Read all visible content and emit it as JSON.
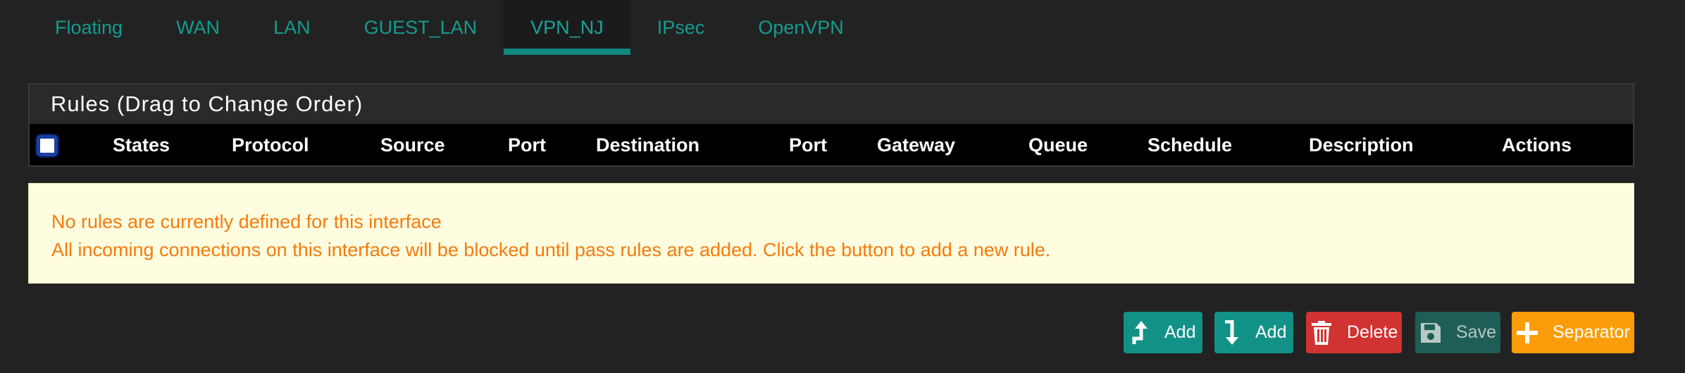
{
  "tabs": [
    {
      "label": "Floating"
    },
    {
      "label": "WAN"
    },
    {
      "label": "LAN"
    },
    {
      "label": "GUEST_LAN"
    },
    {
      "label": "VPN_NJ"
    },
    {
      "label": "IPsec"
    },
    {
      "label": "OpenVPN"
    }
  ],
  "active_tab": "VPN_NJ",
  "panel": {
    "heading": "Rules (Drag to Change Order)",
    "columns": [
      "States",
      "Protocol",
      "Source",
      "Port",
      "Destination",
      "Port",
      "Gateway",
      "Queue",
      "Schedule",
      "Description",
      "Actions"
    ]
  },
  "alert": {
    "line1": "No rules are currently defined for this interface",
    "line2": "All incoming connections on this interface will be blocked until pass rules are added. Click the button to add a new rule."
  },
  "buttons": {
    "add_top": "Add",
    "add_bottom": "Add",
    "delete": "Delete",
    "save": "Save",
    "separator": "Separator"
  },
  "icons": {
    "add_top": "arrow-up-turn-icon",
    "add_bottom": "arrow-down-turn-icon",
    "delete": "trash-icon",
    "save": "floppy-disk-icon",
    "separator": "plus-icon"
  },
  "colors": {
    "background": "#222222",
    "tab_text": "#169b90",
    "tab_active_underline": "#12877e",
    "alert_bg": "#fffde0",
    "alert_text": "#f47b0e",
    "btn_teal": "#129187",
    "btn_red": "#d13232",
    "btn_orange": "#fb9d0a"
  }
}
